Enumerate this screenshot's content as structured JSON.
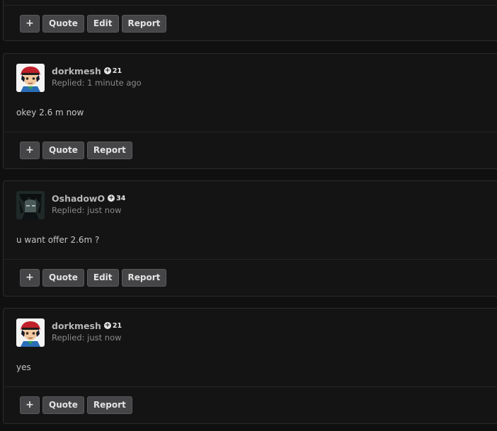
{
  "top_post": {
    "actions": {
      "plus": "+",
      "quote": "Quote",
      "edit": "Edit",
      "report": "Report"
    }
  },
  "posts": [
    {
      "username": "dorkmesh",
      "reputation": "21",
      "reply_time": "Replied: 1 minute ago",
      "body": "okey 2.6 m now",
      "actions": {
        "plus": "+",
        "quote": "Quote",
        "report": "Report"
      }
    },
    {
      "username": "OshadowO",
      "reputation": "34",
      "reply_time": "Replied: just now",
      "body": "u want offer 2.6m ?",
      "actions": {
        "plus": "+",
        "quote": "Quote",
        "edit": "Edit",
        "report": "Report"
      }
    },
    {
      "username": "dorkmesh",
      "reputation": "21",
      "reply_time": "Replied: just now",
      "body": "yes",
      "actions": {
        "plus": "+",
        "quote": "Quote",
        "report": "Report"
      }
    }
  ],
  "colors": {
    "background": "#101011",
    "panel": "#141415",
    "button": "#454547"
  }
}
